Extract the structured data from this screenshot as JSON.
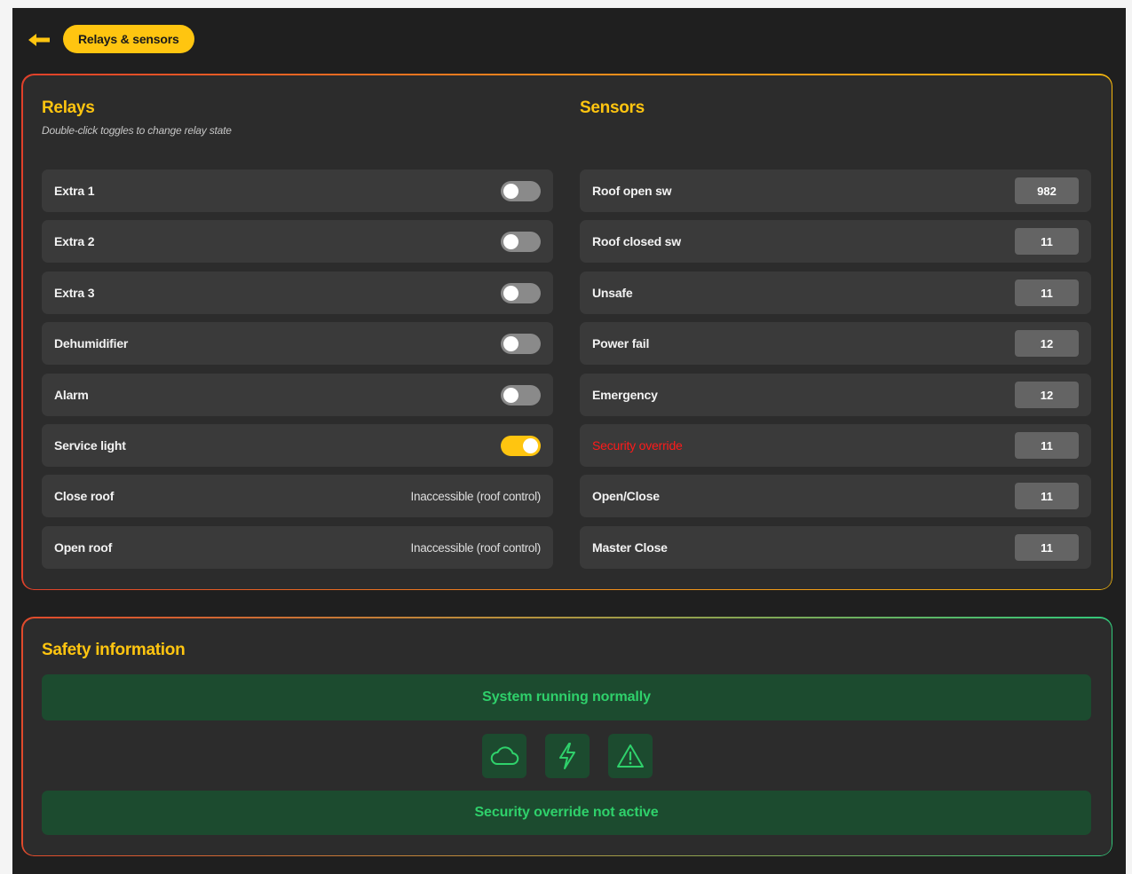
{
  "header": {
    "back_icon": "arrow-left-icon",
    "breadcrumb": "Relays & sensors",
    "accent": "#ffc510"
  },
  "relays": {
    "title": "Relays",
    "subtitle": "Double-click toggles to change relay state",
    "items": [
      {
        "label": "Extra 1",
        "type": "toggle",
        "on": false
      },
      {
        "label": "Extra 2",
        "type": "toggle",
        "on": false
      },
      {
        "label": "Extra 3",
        "type": "toggle",
        "on": false
      },
      {
        "label": "Dehumidifier",
        "type": "toggle",
        "on": false
      },
      {
        "label": "Alarm",
        "type": "toggle",
        "on": false
      },
      {
        "label": "Service light",
        "type": "toggle",
        "on": true
      },
      {
        "label": "Close roof",
        "type": "text",
        "note": "Inaccessible (roof control)"
      },
      {
        "label": "Open roof",
        "type": "text",
        "note": "Inaccessible (roof control)"
      }
    ]
  },
  "sensors": {
    "title": "Sensors",
    "items": [
      {
        "label": "Roof open sw",
        "value": "982",
        "alert": false
      },
      {
        "label": "Roof closed sw",
        "value": "11",
        "alert": false
      },
      {
        "label": "Unsafe",
        "value": "11",
        "alert": false
      },
      {
        "label": "Power fail",
        "value": "12",
        "alert": false
      },
      {
        "label": "Emergency",
        "value": "12",
        "alert": false
      },
      {
        "label": "Security override",
        "value": "11",
        "alert": true
      },
      {
        "label": "Open/Close",
        "value": "11",
        "alert": false
      },
      {
        "label": "Master Close",
        "value": "11",
        "alert": false
      }
    ]
  },
  "safety": {
    "title": "Safety information",
    "status": "System running normally",
    "icons": [
      "cloud-icon",
      "lightning-icon",
      "warning-icon"
    ],
    "override_status": "Security override not active",
    "ok_color": "#2fd16b",
    "alert_color": "#ff1a1a"
  }
}
